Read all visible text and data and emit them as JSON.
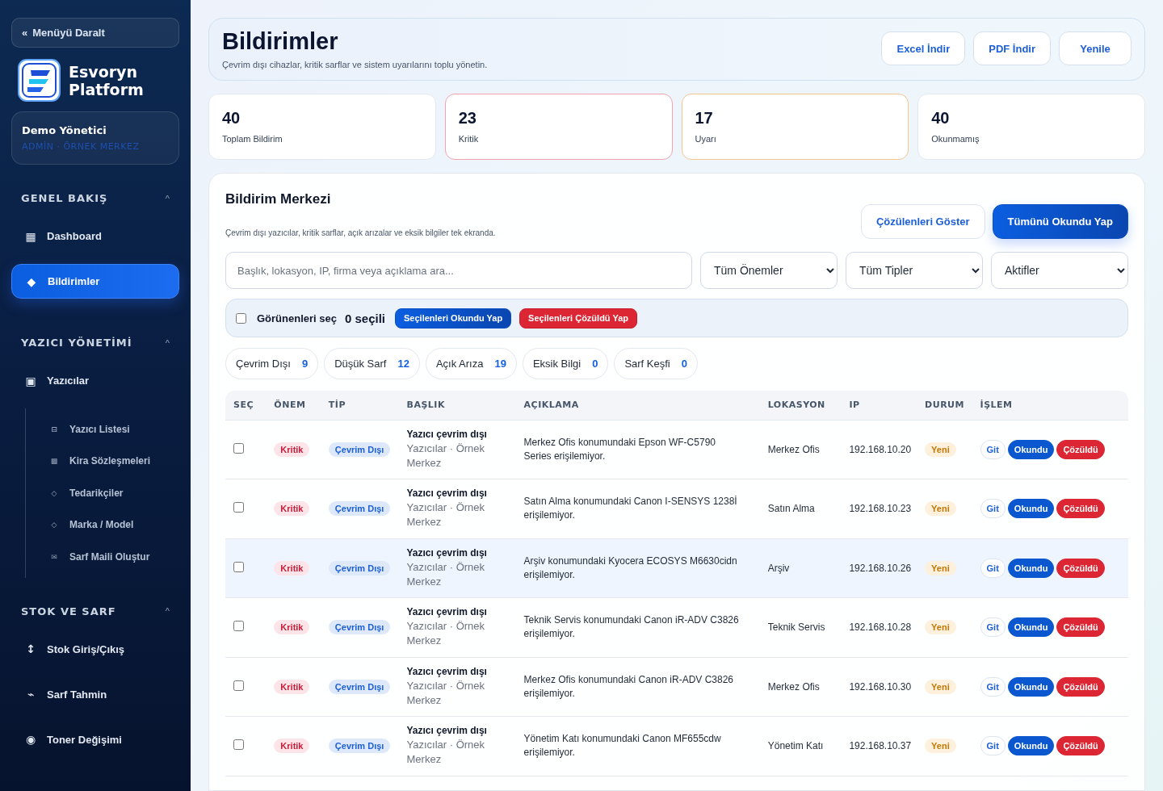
{
  "sidebar": {
    "collapse_button": {
      "icon": "«",
      "label": "Menüyü Daralt"
    },
    "brand": {
      "line1": "Esvoryn",
      "line2": "Platform"
    },
    "user": {
      "name": "Demo Yönetici",
      "role": "ADMİN · ÖRNEK MERKEZ"
    },
    "sections": [
      {
        "title": "GENEL BAKIŞ",
        "caret": "^",
        "expanded": true,
        "items": [
          {
            "icon": "▦",
            "label": "Dashboard",
            "selected": false
          },
          {
            "icon": "◆",
            "label": "Bildirimler",
            "selected": true
          }
        ]
      },
      {
        "title": "YAZICI YÖNETİMİ",
        "caret": "^",
        "expanded": true,
        "items": [
          {
            "icon": "▣",
            "label": "Yazıcılar",
            "selected": false,
            "children": [
              {
                "icon": "⊟",
                "label": "Yazıcı Listesi",
                "selected": false
              },
              {
                "icon": "▩",
                "label": "Kira Sözleşmeleri",
                "selected": false
              },
              {
                "icon": "◇",
                "label": "Tedarikçiler",
                "selected": false
              },
              {
                "icon": "◇",
                "label": "Marka / Model",
                "selected": false
              },
              {
                "icon": "✉",
                "label": "Sarf Maili Oluştur",
                "selected": false
              }
            ]
          }
        ]
      },
      {
        "title": "STOK VE SARF",
        "caret": "^",
        "expanded": true,
        "items": [
          {
            "icon": "↕",
            "label": "Stok Giriş/Çıkış",
            "selected": false
          },
          {
            "icon": "⌁",
            "label": "Sarf Tahmin",
            "selected": false
          },
          {
            "icon": "◉",
            "label": "Toner Değişimi",
            "selected": false
          }
        ]
      }
    ]
  },
  "header": {
    "title": "Bildirimler",
    "subtitle": "Çevrim dışı cihazlar, kritik sarflar ve sistem uyarılarını toplu yönetin.",
    "buttons": [
      "Excel İndir",
      "PDF İndir",
      "Yenile"
    ]
  },
  "stats": [
    {
      "kind": "total",
      "value": "40",
      "label": "Toplam Bildirim"
    },
    {
      "kind": "critical",
      "value": "23",
      "label": "Kritik"
    },
    {
      "kind": "warning",
      "value": "17",
      "label": "Uyarı"
    },
    {
      "kind": "unread",
      "value": "40",
      "label": "Okunmamış"
    }
  ],
  "panel": {
    "title": "Bildirim Merkezi",
    "subtitle": "Çevrim dışı yazıcılar, kritik sarflar, açık arızalar ve eksik bilgiler tek ekranda.",
    "buttons": [
      {
        "kind": "outline",
        "label": "Çözülenleri Göster"
      },
      {
        "kind": "primary",
        "label": "Tümünü Okundu Yap"
      }
    ],
    "search": {
      "placeholder": "Başlık, lokasyon, IP, firma veya açıklama ara..."
    },
    "selects": [
      "Tüm Önemler",
      "Tüm Tipler",
      "Aktifler"
    ],
    "bulk": {
      "checked": false,
      "label": "Görünenleri seç",
      "count": "0 seçili",
      "buttons": [
        {
          "kind": "primary",
          "label": "Seçilenleri Okundu Yap"
        },
        {
          "kind": "danger",
          "label": "Seçilenleri Çözüldü Yap"
        }
      ]
    },
    "chips": [
      {
        "label": "Çevrim Dışı",
        "count": "9"
      },
      {
        "label": "Düşük Sarf",
        "count": "12"
      },
      {
        "label": "Açık Arıza",
        "count": "19"
      },
      {
        "label": "Eksik Bilgi",
        "count": "0"
      },
      {
        "label": "Sarf Keşfi",
        "count": "0"
      }
    ],
    "table": {
      "columns": [
        "SEÇ",
        "ÖNEM",
        "TİP",
        "BAŞLIK",
        "AÇIKLAMA",
        "LOKASYON",
        "IP",
        "DURUM",
        "İŞLEM"
      ],
      "rows": [
        {
          "checked": false,
          "highlighted": false,
          "severity": "Kritik",
          "type": "Çevrim Dışı",
          "title": "Yazıcı çevrim dışı",
          "source": "Yazıcılar · Örnek Merkez",
          "description": "Merkez Ofis konumundaki Epson WF-C5790 Series erişilemiyor.",
          "location": "Merkez Ofis",
          "ip": "192.168.10.20",
          "status": "Yeni",
          "actions": [
            "Git",
            "Okundu",
            "Çözüldü"
          ]
        },
        {
          "checked": false,
          "highlighted": false,
          "severity": "Kritik",
          "type": "Çevrim Dışı",
          "title": "Yazıcı çevrim dışı",
          "source": "Yazıcılar · Örnek Merkez",
          "description": "Satın Alma konumundaki Canon I-SENSYS 1238İ erişilemiyor.",
          "location": "Satın Alma",
          "ip": "192.168.10.23",
          "status": "Yeni",
          "actions": [
            "Git",
            "Okundu",
            "Çözüldü"
          ]
        },
        {
          "checked": false,
          "highlighted": true,
          "severity": "Kritik",
          "type": "Çevrim Dışı",
          "title": "Yazıcı çevrim dışı",
          "source": "Yazıcılar · Örnek Merkez",
          "description": "Arşiv konumundaki Kyocera ECOSYS M6630cidn erişilemiyor.",
          "location": "Arşiv",
          "ip": "192.168.10.26",
          "status": "Yeni",
          "actions": [
            "Git",
            "Okundu",
            "Çözüldü"
          ]
        },
        {
          "checked": false,
          "highlighted": false,
          "severity": "Kritik",
          "type": "Çevrim Dışı",
          "title": "Yazıcı çevrim dışı",
          "source": "Yazıcılar · Örnek Merkez",
          "description": "Teknik Servis konumundaki Canon iR-ADV C3826 erişilemiyor.",
          "location": "Teknik Servis",
          "ip": "192.168.10.28",
          "status": "Yeni",
          "actions": [
            "Git",
            "Okundu",
            "Çözüldü"
          ]
        },
        {
          "checked": false,
          "highlighted": false,
          "severity": "Kritik",
          "type": "Çevrim Dışı",
          "title": "Yazıcı çevrim dışı",
          "source": "Yazıcılar · Örnek Merkez",
          "description": "Merkez Ofis konumundaki Canon iR-ADV C3826 erişilemiyor.",
          "location": "Merkez Ofis",
          "ip": "192.168.10.30",
          "status": "Yeni",
          "actions": [
            "Git",
            "Okundu",
            "Çözüldü"
          ]
        },
        {
          "checked": false,
          "highlighted": false,
          "severity": "Kritik",
          "type": "Çevrim Dışı",
          "title": "Yazıcı çevrim dışı",
          "source": "Yazıcılar · Örnek Merkez",
          "description": "Yönetim Katı konumundaki Canon MF655cdw erişilemiyor.",
          "location": "Yönetim Katı",
          "ip": "192.168.10.37",
          "status": "Yeni",
          "actions": [
            "Git",
            "Okundu",
            "Çözüldü"
          ]
        }
      ]
    }
  }
}
